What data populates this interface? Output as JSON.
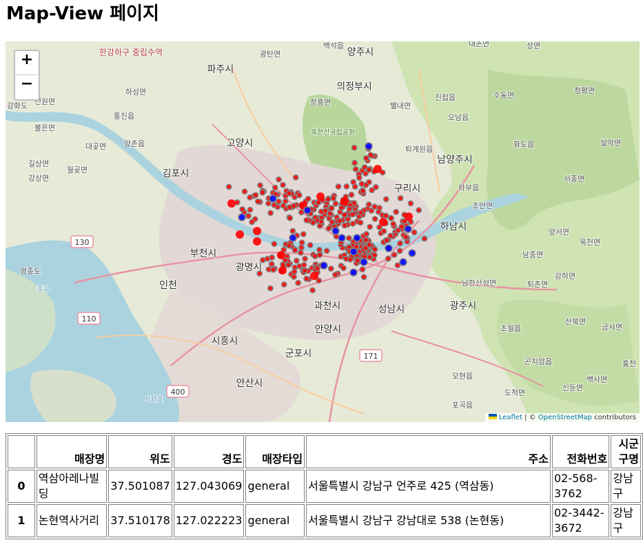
{
  "page": {
    "title": "Map-View 페이지"
  },
  "map": {
    "zoom_in_label": "+",
    "zoom_out_label": "−",
    "attribution": {
      "leaflet": "Leaflet",
      "separator": " | © ",
      "osm": "OpenStreetMap",
      "suffix": " contributors"
    },
    "marker_colors": {
      "general": "#ff0000",
      "special": "#0000ff",
      "stroke": "#808080"
    },
    "place_labels": [
      {
        "text": "파주시",
        "cls": "city"
      },
      {
        "text": "양주시",
        "cls": "city"
      },
      {
        "text": "의정부시",
        "cls": "city"
      },
      {
        "text": "고양시",
        "cls": "city"
      },
      {
        "text": "김포시",
        "cls": "city"
      },
      {
        "text": "남양주시",
        "cls": "city"
      },
      {
        "text": "구리시",
        "cls": "city"
      },
      {
        "text": "하남시",
        "cls": "city"
      },
      {
        "text": "부천시",
        "cls": "city"
      },
      {
        "text": "인천",
        "cls": "city"
      },
      {
        "text": "광명시",
        "cls": "city"
      },
      {
        "text": "과천시",
        "cls": "city"
      },
      {
        "text": "성남시",
        "cls": "city"
      },
      {
        "text": "광주시",
        "cls": "city"
      },
      {
        "text": "시흥시",
        "cls": "city"
      },
      {
        "text": "안양시",
        "cls": "city"
      },
      {
        "text": "군포시",
        "cls": "city"
      },
      {
        "text": "안산시",
        "cls": "city"
      },
      {
        "text": "한강하구 중립수역",
        "cls": "red"
      },
      {
        "text": "북한산국립공원",
        "cls": "park"
      },
      {
        "text": "강화도",
        "cls": "town"
      },
      {
        "text": "영종도",
        "cls": "town"
      },
      {
        "text": "하성면",
        "cls": "town"
      },
      {
        "text": "통진읍",
        "cls": "town"
      },
      {
        "text": "양촌읍",
        "cls": "town"
      },
      {
        "text": "대곶면",
        "cls": "town"
      },
      {
        "text": "장흥면",
        "cls": "town"
      },
      {
        "text": "별내면",
        "cls": "town"
      },
      {
        "text": "진접읍",
        "cls": "town"
      },
      {
        "text": "오남읍",
        "cls": "town"
      },
      {
        "text": "수동면",
        "cls": "town"
      },
      {
        "text": "퇴계원읍",
        "cls": "town"
      },
      {
        "text": "화도읍",
        "cls": "town"
      },
      {
        "text": "와부읍",
        "cls": "town"
      },
      {
        "text": "조안면",
        "cls": "town"
      },
      {
        "text": "서종면",
        "cls": "town"
      },
      {
        "text": "양서면",
        "cls": "town"
      },
      {
        "text": "옥천면",
        "cls": "town"
      },
      {
        "text": "남종면",
        "cls": "town"
      },
      {
        "text": "퇴촌면",
        "cls": "town"
      },
      {
        "text": "강하면",
        "cls": "town"
      },
      {
        "text": "남한산성면",
        "cls": "town"
      },
      {
        "text": "초월읍",
        "cls": "town"
      },
      {
        "text": "곤지암읍",
        "cls": "town"
      },
      {
        "text": "모현읍",
        "cls": "town"
      },
      {
        "text": "포곡읍",
        "cls": "town"
      },
      {
        "text": "도척면",
        "cls": "town"
      },
      {
        "text": "신둔면",
        "cls": "town"
      },
      {
        "text": "백사면",
        "cls": "town"
      },
      {
        "text": "산북면",
        "cls": "town"
      },
      {
        "text": "금사면",
        "cls": "town"
      },
      {
        "text": "상면",
        "cls": "town"
      },
      {
        "text": "청평면",
        "cls": "town"
      },
      {
        "text": "설악면",
        "cls": "town"
      },
      {
        "text": "백석읍",
        "cls": "town"
      },
      {
        "text": "광탄면",
        "cls": "town"
      },
      {
        "text": "내촌면",
        "cls": "town"
      },
      {
        "text": "선원면",
        "cls": "town"
      },
      {
        "text": "불은면",
        "cls": "town"
      },
      {
        "text": "길상면",
        "cls": "town"
      },
      {
        "text": "월곶면",
        "cls": "town"
      },
      {
        "text": "강상면",
        "cls": "town"
      },
      {
        "text": "홍천",
        "cls": "town"
      },
      {
        "text": "시화호",
        "cls": "water"
      },
      {
        "text": "중구",
        "cls": "water"
      },
      {
        "text": "130",
        "cls": "shield"
      },
      {
        "text": "110",
        "cls": "shield"
      },
      {
        "text": "171",
        "cls": "shield"
      },
      {
        "text": "400",
        "cls": "shield"
      }
    ]
  },
  "table": {
    "columns": [
      "",
      "매장명",
      "위도",
      "경도",
      "매장타입",
      "주소",
      "전화번호",
      "시군구명"
    ],
    "rows": [
      {
        "index": "0",
        "name": "역삼아레나빌딩",
        "lat": "37.501087",
        "lng": "127.043069",
        "type": "general",
        "address": "서울특별시 강남구 언주로 425 (역삼동)",
        "phone": "02-568-3762",
        "district": "강남구"
      },
      {
        "index": "1",
        "name": "논현역사거리",
        "lat": "37.510178",
        "lng": "127.022223",
        "type": "general",
        "address": "서울특별시 강남구 강남대로 538 (논현동)",
        "phone": "02-3442-3672",
        "district": "강남구"
      }
    ]
  }
}
